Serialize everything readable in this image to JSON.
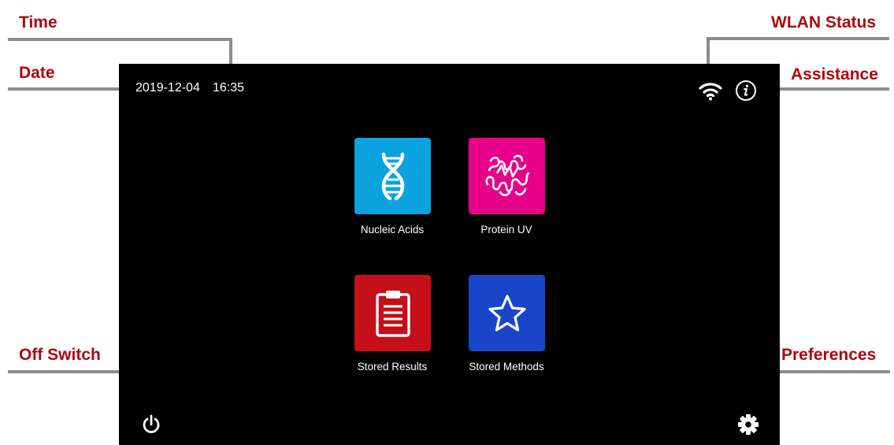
{
  "callouts": {
    "time": "Time",
    "date": "Date",
    "wlan_status": "WLAN Status",
    "assistance": "Assistance",
    "off_switch": "Off Switch",
    "preferences": "Preferences"
  },
  "status_bar": {
    "date": "2019-12-04",
    "time": "16:35",
    "wifi_icon": "wifi-icon",
    "info_icon": "info-icon"
  },
  "tiles": [
    {
      "label": "Nucleic Acids",
      "icon": "dna-icon",
      "color": "#0aa3df"
    },
    {
      "label": "Protein UV",
      "icon": "protein-icon",
      "color": "#e8008a"
    },
    {
      "label": "Stored Results",
      "icon": "clipboard-icon",
      "color": "#c50f19"
    },
    {
      "label": "Stored Methods",
      "icon": "star-icon",
      "color": "#1946c8"
    }
  ],
  "bottom_bar": {
    "power_icon": "power-icon",
    "settings_icon": "gear-icon"
  },
  "colors": {
    "callout_text": "#b0070f",
    "callout_line": "#8c8c8c",
    "screen_background": "#000000"
  }
}
